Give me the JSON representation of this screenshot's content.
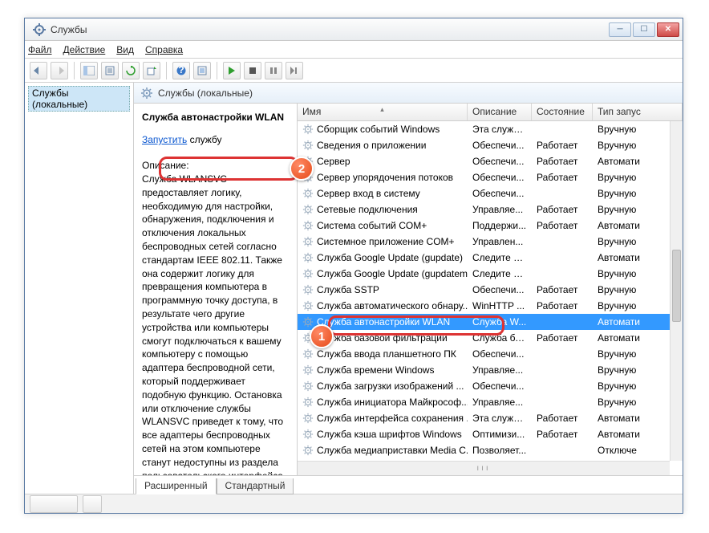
{
  "window": {
    "title": "Службы"
  },
  "menu": {
    "file": "Файл",
    "action": "Действие",
    "view": "Вид",
    "help": "Справка"
  },
  "tree": {
    "root": "Службы (локальные)"
  },
  "view_header": "Службы (локальные)",
  "detail": {
    "name": "Служба автонастройки WLAN",
    "action_link": "Запустить",
    "action_suffix": " службу",
    "desc_label": "Описание:",
    "desc_text": "Служба WLANSVC предоставляет логику, необходимую для настройки, обнаружения, подключения и отключения локальных беспроводных сетей согласно стандартам IEEE 802.11. Также она содержит логику для превращения компьютера в программную точку доступа, в результате чего другие устройства или компьютеры смогут подключаться к вашему компьютеру с помощью адаптера беспроводной сети, который поддерживает подобную функцию. Остановка или отключение службы WLANSVC приведет к тому, что все адаптеры беспроводных сетей на этом компьютере станут недоступны из раздела пользовательского интерфейса"
  },
  "columns": {
    "name": "Имя",
    "desc": "Описание",
    "state": "Состояние",
    "start": "Тип запус"
  },
  "services": [
    {
      "name": "Сборщик событий Windows",
      "desc": "Эта служб...",
      "state": "",
      "start": "Вручную"
    },
    {
      "name": "Сведения о приложении",
      "desc": "Обеспечи...",
      "state": "Работает",
      "start": "Вручную"
    },
    {
      "name": "Сервер",
      "desc": "Обеспечи...",
      "state": "Работает",
      "start": "Автомати"
    },
    {
      "name": "Сервер упорядочения потоков",
      "desc": "Обеспечи...",
      "state": "Работает",
      "start": "Вручную"
    },
    {
      "name": "Сервер вход в систему",
      "desc": "Обеспечи...",
      "state": "",
      "start": "Вручную"
    },
    {
      "name": "Сетевые подключения",
      "desc": "Управляе...",
      "state": "Работает",
      "start": "Вручную"
    },
    {
      "name": "Система событий COM+",
      "desc": "Поддержи...",
      "state": "Работает",
      "start": "Автомати"
    },
    {
      "name": "Системное приложение COM+",
      "desc": "Управлен...",
      "state": "",
      "start": "Вручную"
    },
    {
      "name": "Служба Google Update (gupdate)",
      "desc": "Следите за...",
      "state": "",
      "start": "Автомати"
    },
    {
      "name": "Служба Google Update (gupdatem)",
      "desc": "Следите за...",
      "state": "",
      "start": "Вручную"
    },
    {
      "name": "Служба SSTP",
      "desc": "Обеспечи...",
      "state": "Работает",
      "start": "Вручную"
    },
    {
      "name": "Служба автоматического обнару...",
      "desc": "WinHTTP ...",
      "state": "Работает",
      "start": "Вручную"
    },
    {
      "name": "Служба автонастройки WLAN",
      "desc": "Служба W...",
      "state": "",
      "start": "Автомати",
      "selected": true
    },
    {
      "name": "Служба базовой фильтрации",
      "desc": "Служба ба...",
      "state": "Работает",
      "start": "Автомати"
    },
    {
      "name": "Служба ввода планшетного ПК",
      "desc": "Обеспечи...",
      "state": "",
      "start": "Вручную"
    },
    {
      "name": "Служба времени Windows",
      "desc": "Управляе...",
      "state": "",
      "start": "Вручную"
    },
    {
      "name": "Служба загрузки изображений ...",
      "desc": "Обеспечи...",
      "state": "",
      "start": "Вручную"
    },
    {
      "name": "Служба инициатора Майкрософ...",
      "desc": "Управляе...",
      "state": "",
      "start": "Вручную"
    },
    {
      "name": "Служба интерфейса сохранения ...",
      "desc": "Эта служб...",
      "state": "Работает",
      "start": "Автомати"
    },
    {
      "name": "Служба кэша шрифтов Windows",
      "desc": "Оптимизи...",
      "state": "Работает",
      "start": "Автомати"
    },
    {
      "name": "Служба медиаприставки Media C...",
      "desc": "Позволяет...",
      "state": "",
      "start": "Отключе"
    }
  ],
  "tabs": {
    "ext": "Расширенный",
    "std": "Стандартный"
  },
  "badges": {
    "one": "1",
    "two": "2"
  }
}
